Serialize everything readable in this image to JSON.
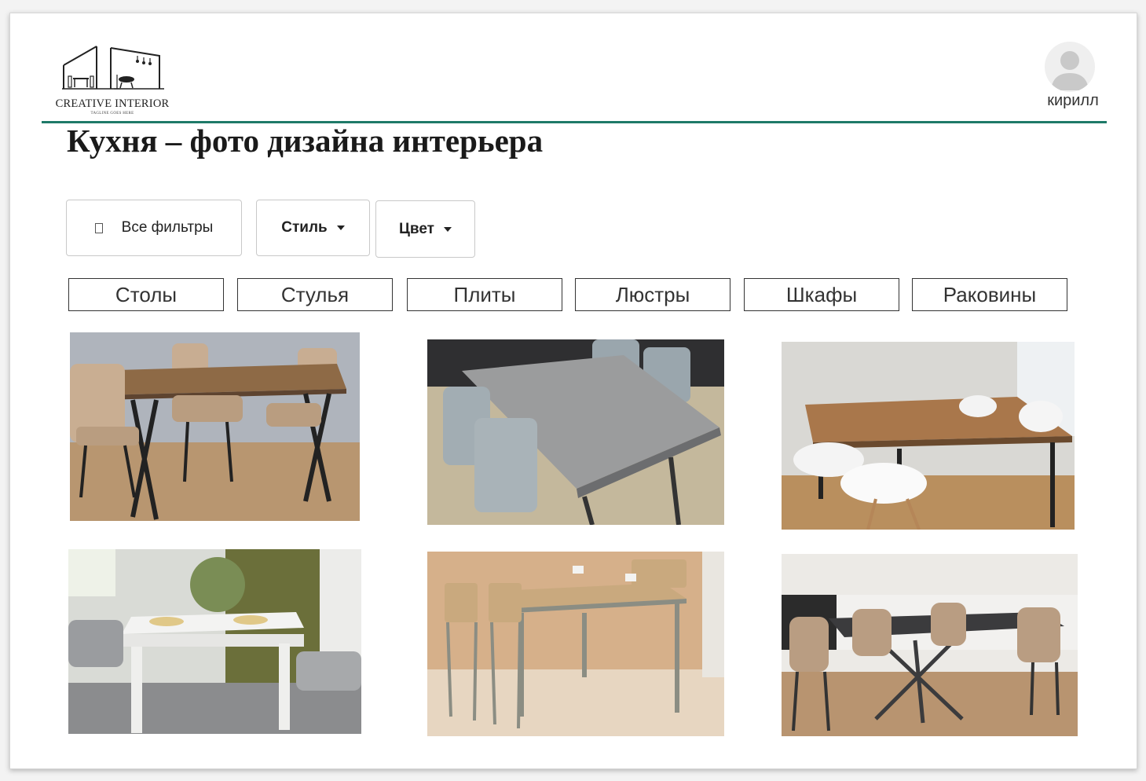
{
  "header": {
    "logo_text": "CREATIVE INTERIOR",
    "logo_tagline": "TAGLINE GOES HERE",
    "username": "кирилл"
  },
  "page_title": "Кухня – фото дизайна интерьера",
  "filters": {
    "all_label": "Все фильтры",
    "style_label": "Стиль",
    "color_label": "Цвет"
  },
  "categories": [
    "Столы",
    "Стулья",
    "Плиты",
    "Люстры",
    "Шкафы",
    "Раковины"
  ],
  "gallery": [
    {
      "description": "wooden table with beige quilted chairs"
    },
    {
      "description": "grey concrete table with grey chairs"
    },
    {
      "description": "oak table with white chairs"
    },
    {
      "description": "white table with grey chairs"
    },
    {
      "description": "light wood table with metal chairs"
    },
    {
      "description": "dark extendable table with beige chairs"
    }
  ],
  "colors": {
    "accent_line": "#1e7a68",
    "text_dark": "#1a1a1a"
  }
}
